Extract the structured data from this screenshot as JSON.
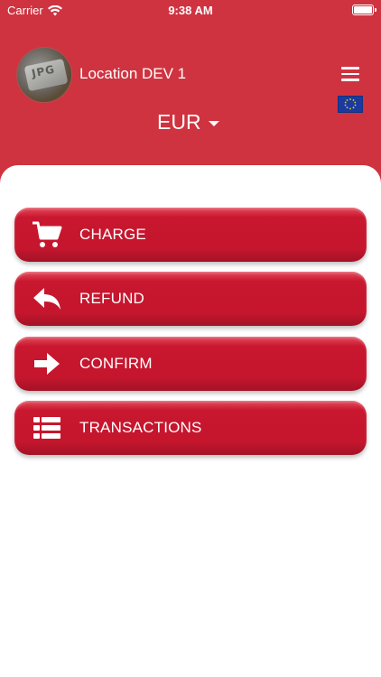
{
  "status_bar": {
    "carrier": "Carrier",
    "time": "9:38 AM",
    "battery_level": 1.0
  },
  "header": {
    "avatar_text": "JPG",
    "location_name": "Location DEV 1",
    "currency": "EUR",
    "flag_icon": "eu-flag-icon",
    "menu_icon": "hamburger-menu-icon"
  },
  "actions": [
    {
      "label": "CHARGE",
      "icon": "cart-icon"
    },
    {
      "label": "REFUND",
      "icon": "reply-icon"
    },
    {
      "label": "CONFIRM",
      "icon": "arrow-right-icon"
    },
    {
      "label": "TRANSACTIONS",
      "icon": "list-icon"
    }
  ],
  "colors": {
    "header_bg": "#cf3340",
    "button_bg": "#c5162d",
    "sheet_bg": "#ffffff"
  }
}
